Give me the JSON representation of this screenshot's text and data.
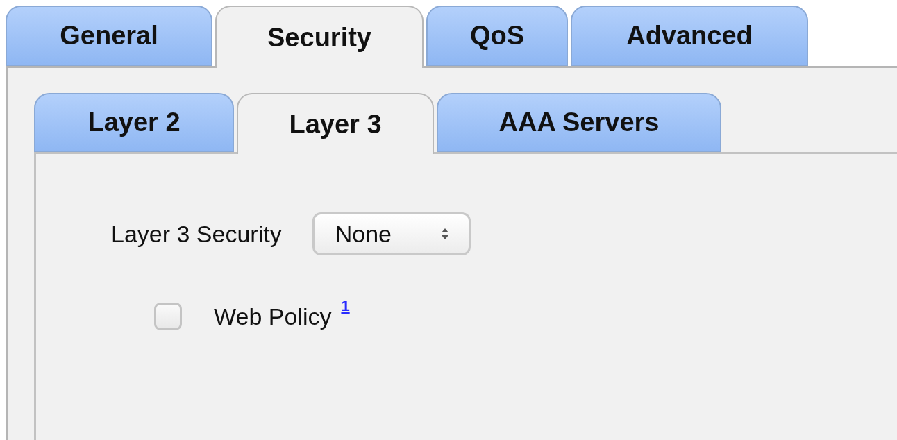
{
  "tabs": [
    {
      "label": "General",
      "selected": false
    },
    {
      "label": "Security",
      "selected": true
    },
    {
      "label": "QoS",
      "selected": false
    },
    {
      "label": "Advanced",
      "selected": false
    }
  ],
  "subtabs": [
    {
      "label": "Layer 2",
      "selected": false
    },
    {
      "label": "Layer 3",
      "selected": true
    },
    {
      "label": "AAA Servers",
      "selected": false
    }
  ],
  "layer3_security": {
    "label": "Layer 3 Security",
    "value": "None"
  },
  "web_policy": {
    "label": "Web Policy",
    "checked": false,
    "footnote": "1"
  }
}
